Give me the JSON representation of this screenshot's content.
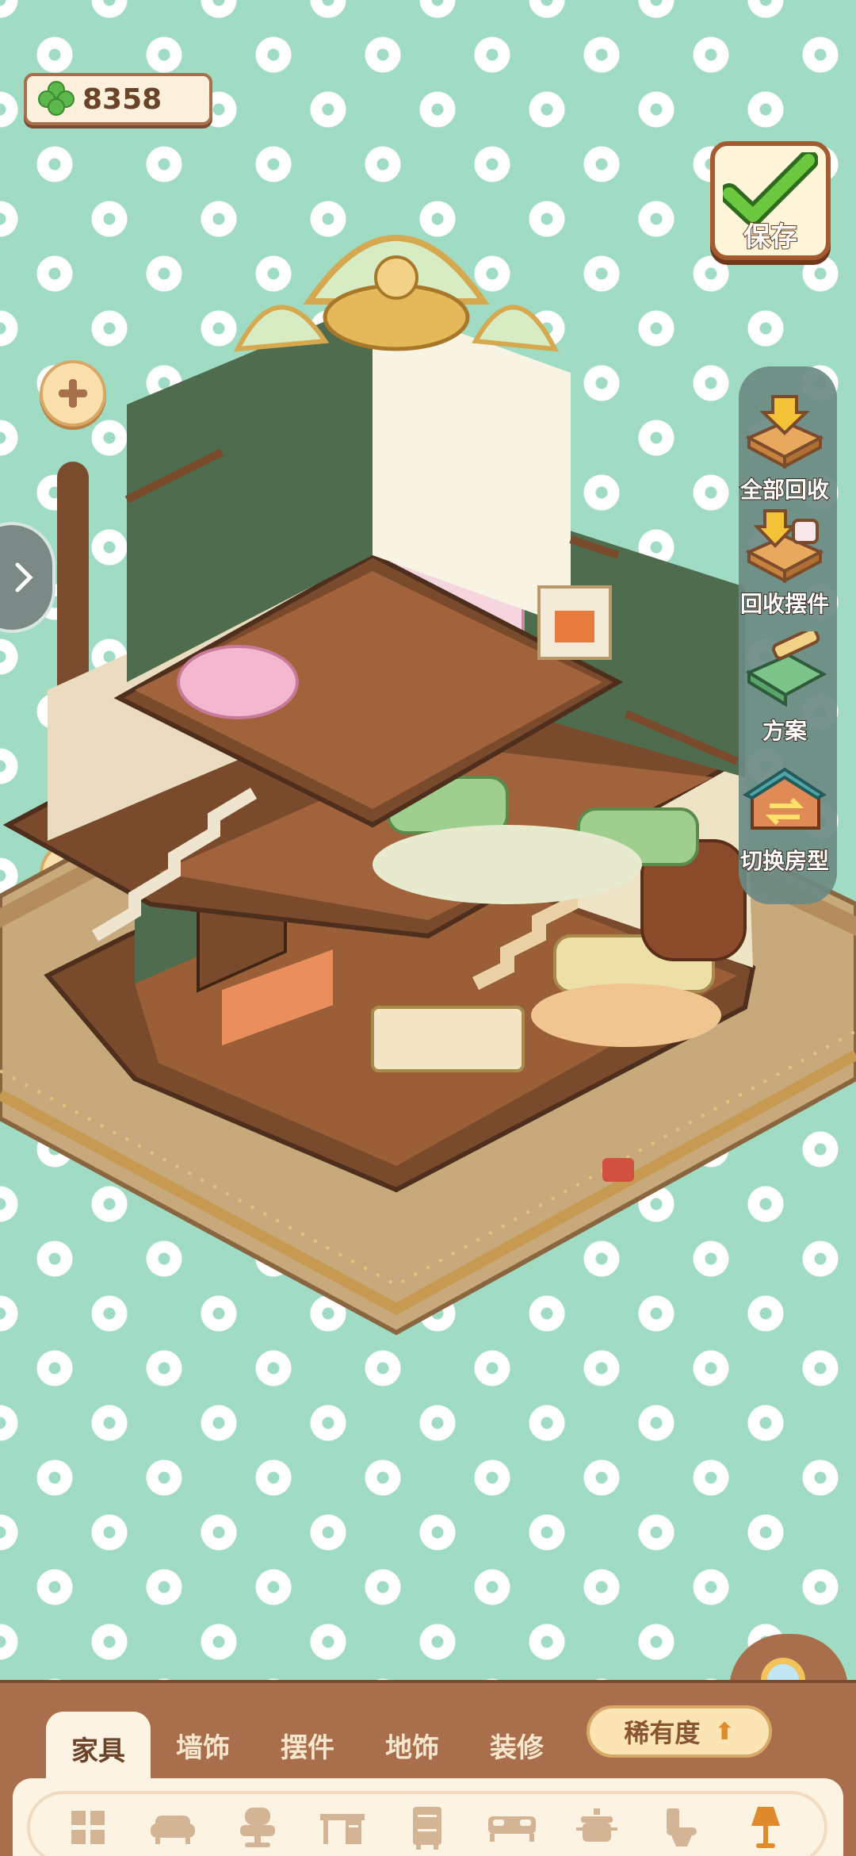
{
  "currency": {
    "icon": "clover-icon",
    "value": "8358"
  },
  "save_button": {
    "label": "保存"
  },
  "tools": [
    {
      "icon": "recall-all-icon",
      "label": "全部回收"
    },
    {
      "icon": "recall-decor-icon",
      "label": "回收摆件"
    },
    {
      "icon": "plan-icon",
      "label": "方案"
    },
    {
      "icon": "switch-house-icon",
      "label": "切换房型"
    }
  ],
  "tabs": [
    {
      "label": "家具",
      "active": true
    },
    {
      "label": "墙饰",
      "active": false
    },
    {
      "label": "摆件",
      "active": false
    },
    {
      "label": "地饰",
      "active": false
    },
    {
      "label": "装修",
      "active": false
    }
  ],
  "rarity": {
    "label": "稀有度",
    "icon": "arrow-up-icon"
  },
  "categories": [
    "grid-all-icon",
    "sofa-icon",
    "chair-icon",
    "desk-icon",
    "cabinet-icon",
    "bed-icon",
    "stove-icon",
    "toilet-icon",
    "lamp-icon"
  ],
  "colors": {
    "background": "#9fdcc3",
    "wood": "#a96e4c",
    "accent": "#e08b2b",
    "panel": "#fdf3e3"
  }
}
